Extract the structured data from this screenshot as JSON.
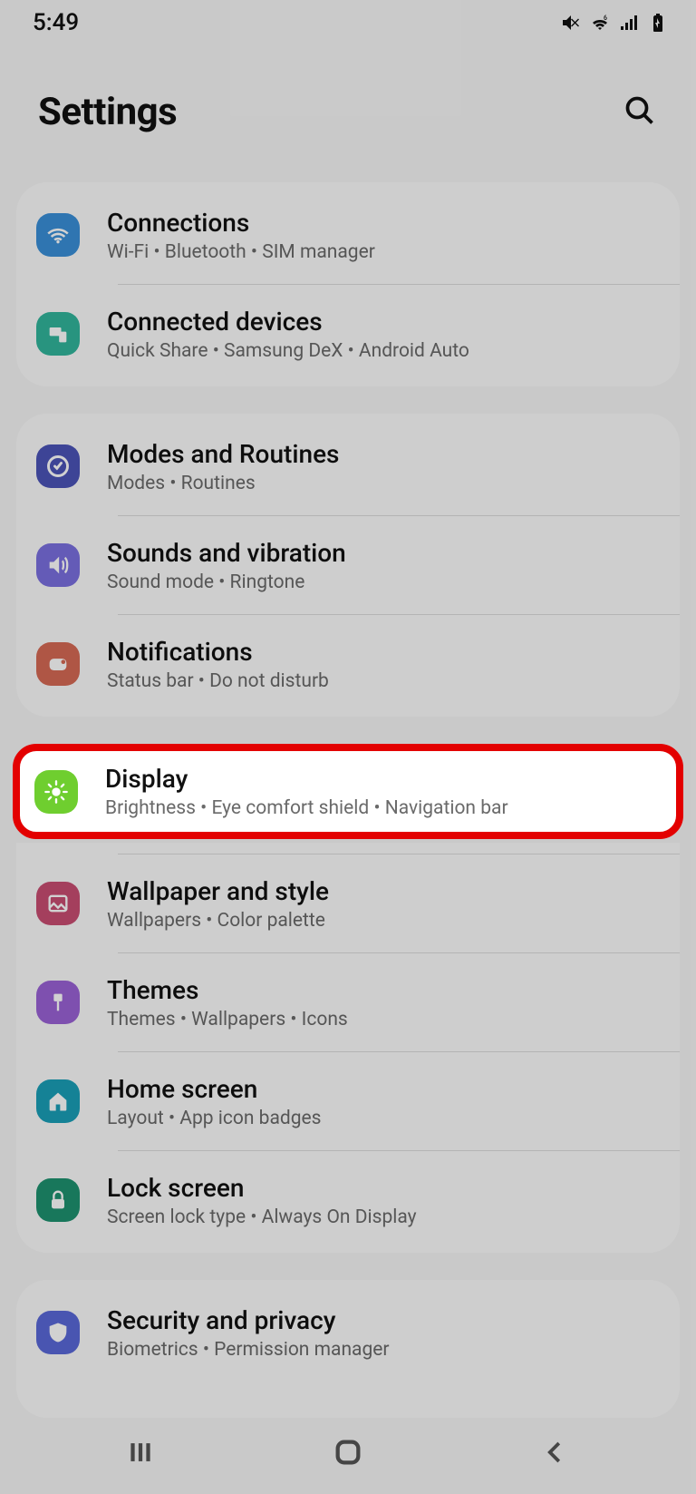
{
  "status": {
    "time": "5:49"
  },
  "header": {
    "title": "Settings"
  },
  "items": {
    "connections": {
      "title": "Connections",
      "sub": "Wi-Fi  •  Bluetooth  •  SIM manager"
    },
    "connected": {
      "title": "Connected devices",
      "sub": "Quick Share  •  Samsung DeX  •  Android Auto"
    },
    "modes": {
      "title": "Modes and Routines",
      "sub": "Modes  •  Routines"
    },
    "sounds": {
      "title": "Sounds and vibration",
      "sub": "Sound mode  •  Ringtone"
    },
    "notifications": {
      "title": "Notifications",
      "sub": "Status bar  •  Do not disturb"
    },
    "display": {
      "title": "Display",
      "sub": "Brightness  •  Eye comfort shield  •  Navigation bar"
    },
    "wallpaper": {
      "title": "Wallpaper and style",
      "sub": "Wallpapers  •  Color palette"
    },
    "themes": {
      "title": "Themes",
      "sub": "Themes  •  Wallpapers  •  Icons"
    },
    "home": {
      "title": "Home screen",
      "sub": "Layout  •  App icon badges"
    },
    "lock": {
      "title": "Lock screen",
      "sub": "Screen lock type  •  Always On Display"
    },
    "security": {
      "title": "Security and privacy",
      "sub": "Biometrics  •  Permission manager"
    }
  },
  "highlighted": "display"
}
